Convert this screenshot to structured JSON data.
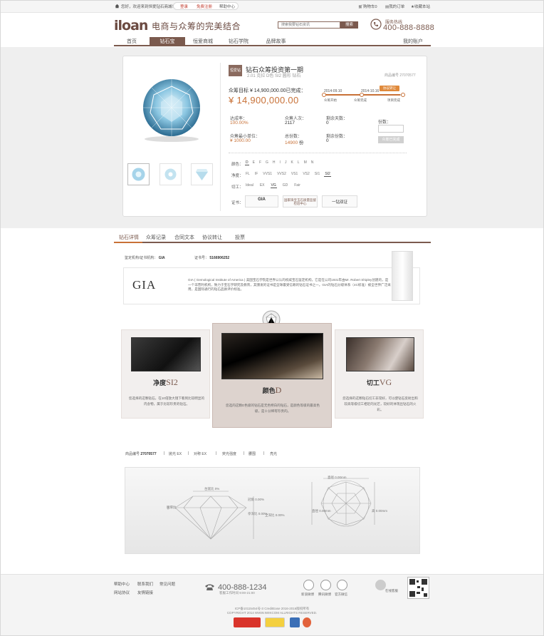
{
  "topbar": {
    "welcome": "您好，欢迎来到恒爱钻石商城！",
    "login": "登录",
    "register": "免费注册",
    "help": "帮助中心",
    "cart": "购物车0",
    "orders": "我的订单",
    "favorite": "收藏本站"
  },
  "header": {
    "logo": "iloan",
    "slogan": "电商与众筹的完美结合",
    "search_placeholder": "搜索我要钻石资讯",
    "search_button": "搜索",
    "hotline_label": "服务热线",
    "hotline_number": "400-888-8888"
  },
  "nav": {
    "items": [
      "首页",
      "钻石宝",
      "恒爱商城",
      "钻石学院",
      "品牌故事"
    ],
    "active": "钻石宝",
    "account": "我的账户"
  },
  "product": {
    "tag": "恒爱钻",
    "title": "钻石众筹投资第一期",
    "subtitle": "2.01 克拉 D色 SI2 圆形 钻石",
    "code": "商品编号 27070577",
    "goal_label": "众筹目标 ¥ 14,900,000.00已完成：",
    "goal_amount": "¥ 14,900,000.00",
    "date_start": "2014-09.10",
    "date_end": "2014-10.16",
    "transfer_badge": "协议转让",
    "progress_fraction": 0.96,
    "progress_labels": [
      "众筹开始",
      "众筹完成",
      "项目完成"
    ],
    "stats": {
      "rate_label": "达成率：",
      "rate_value": "100.00%",
      "people_label": "众筹人次：",
      "people_value": "2117",
      "days_label": "剩余天数：",
      "days_value": "0",
      "min_label": "众筹最小单位：",
      "min_value": "¥ 1000.00",
      "total_label": "总份数：",
      "total_value": "14900",
      "total_unit": "份",
      "remain_label": "剩余份数：",
      "remain_value": "0"
    },
    "share_label": "份数：",
    "share_button": "众筹已完成",
    "attrs": {
      "color_label": "颜色：",
      "colors": [
        "D",
        "E",
        "F",
        "G",
        "H",
        "I",
        "J",
        "K",
        "L",
        "M",
        "N"
      ],
      "color_selected": "D",
      "clarity_label": "净度：",
      "clarities": [
        "FL",
        "IF",
        "VVS1",
        "VVS2",
        "VS1",
        "VS2",
        "SI1",
        "SI2"
      ],
      "clarity_selected": "SI2",
      "cut_label": "切工：",
      "cuts": [
        "Ideal",
        "EX",
        "VG",
        "GD",
        "Fair"
      ],
      "cut_selected": "VG",
      "cert_label": "证书：",
      "certs": [
        "GIA",
        "国家珠宝玉石质量监督检验中心",
        "一钻双证"
      ]
    }
  },
  "detail_tabs": {
    "items": [
      "钻石详情",
      "众筹记录",
      "合同文本",
      "协议转让",
      "投票"
    ],
    "active": "钻石详情"
  },
  "certificate": {
    "authority_label": "鉴定机构/证书机构：",
    "authority_value": "GIA",
    "number_label": "证书号：",
    "number_value": "5166906252",
    "gia_logo": "GIA",
    "gia_desc": "GIA ( Gemological Institute of America ) 美国宝石学院是世界公认的权威宝石鉴定机构，它是在公司1931年由Mr. Robert Shipley创建的，是一个非营利机构，致力于宝石学研究及教育，其颁发的证书是全球最受信赖的钻石证书之一。GIA的钻石分级体系（4C标准）被全世界广泛采用，是国际通行的钻石品质评价标准。"
  },
  "grades": [
    {
      "title_prefix": "净度",
      "title_grade": "SI2",
      "desc": "您选择的这颗钻石，在10倍放大镜下看到比较明显的内含物，属于比较珍贵的钻石。"
    },
    {
      "title_prefix": "颜色",
      "title_grade": "D",
      "desc": "您选的这颗D色级的钻石是无色特白的钻石，是颜色等级的最高色级，是十分稀有珍贵的。"
    },
    {
      "title_prefix": "切工",
      "title_grade": "VG",
      "desc": "您选择的这颗钻石切工非常好，可以使钻石反射出和较高等级切工相近的光芒，较好的体现出钻石的火彩。"
    }
  ],
  "specs": {
    "code_label": "商品编号",
    "code_value": "27070577",
    "polish_label": "抛光",
    "polish_value": "EX",
    "symmetry_label": "对称",
    "symmetry_value": "EX",
    "fluor_label": "荧光强度",
    "fluor_value": "",
    "girdle_label": "腰围",
    "girdle_value": "",
    "culet_label": "亮光",
    "culet_value": "",
    "diagram_labels": {
      "table": "台宽比 0%",
      "crown": "冠角 0.00%",
      "girdle": "腰厚比",
      "pavilion": "亭深比 0.00%",
      "depth": "全深比 0.00%",
      "diameter_top": "直径 0.00mm",
      "diameter_left": "直径 0.00mm",
      "height": "高 0.00mm"
    }
  },
  "footer": {
    "links": [
      "帮助中心",
      "联系我们",
      "常见问题",
      "网站协议",
      "友情链接"
    ],
    "hotline": "400-888-1234",
    "hours": "客服工作时间 9:00-21:00",
    "social": [
      "新浪微博",
      "腾讯微博",
      "官方微信",
      "在线客服"
    ],
    "icp": "ICP备10115454号-3 CreditEase 2016-2016版权所有",
    "copyright": "COPYRIGHT 2014 WWW.IWIKCOM ALLRIGHTS RESERVED."
  }
}
